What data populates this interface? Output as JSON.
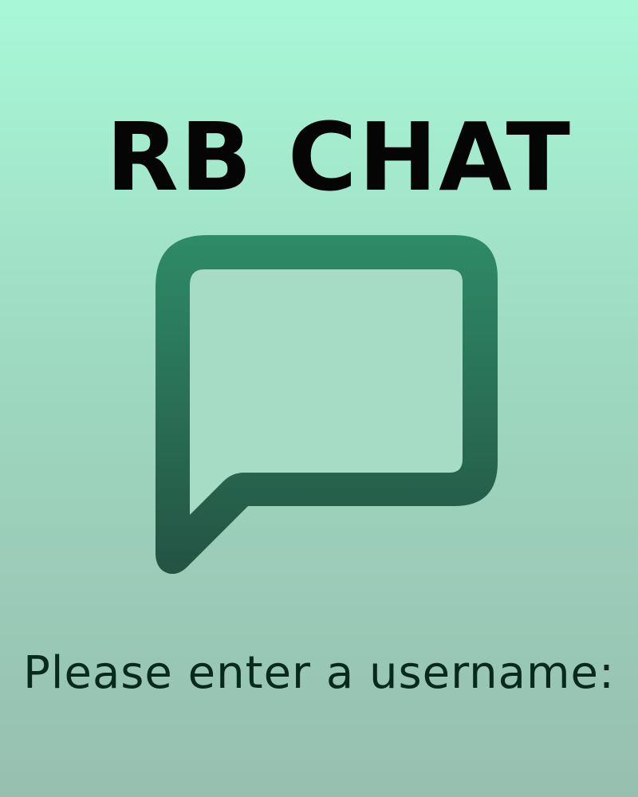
{
  "app": {
    "title": "RB CHAT",
    "logo_icon": "chat-bubble-icon",
    "prompt": "Please enter a username:"
  },
  "colors": {
    "background_top": "#a8f8d8",
    "background_bottom": "#97bfb0",
    "title_text": "#050505",
    "icon_top": "#2e8b68",
    "icon_bottom": "#245343",
    "prompt_text": "#082a1d"
  }
}
